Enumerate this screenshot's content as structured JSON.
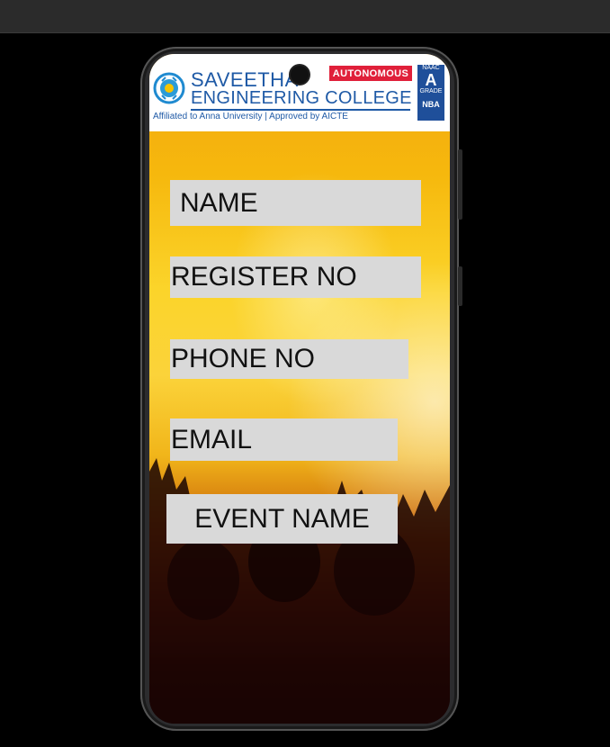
{
  "header": {
    "college_line1": "SAVEETHA",
    "college_line2": "ENGINEERING COLLEGE",
    "affiliation": "Affiliated to Anna University | Approved by AICTE",
    "autonomous_badge": "AUTONOMOUS",
    "naac_label": "NAAC",
    "naac_grade": "A",
    "grade_word": "GRADE",
    "nba_label": "NBA"
  },
  "form": {
    "name_label": "NAME",
    "register_label": "REGISTER NO",
    "phone_label": "PHONE NO",
    "email_label": "EMAIL",
    "event_button_label": "EVENT NAME"
  },
  "colors": {
    "brand_blue": "#1f5aa6",
    "badge_red": "#e0203a",
    "field_gray": "#d9d9d9"
  }
}
